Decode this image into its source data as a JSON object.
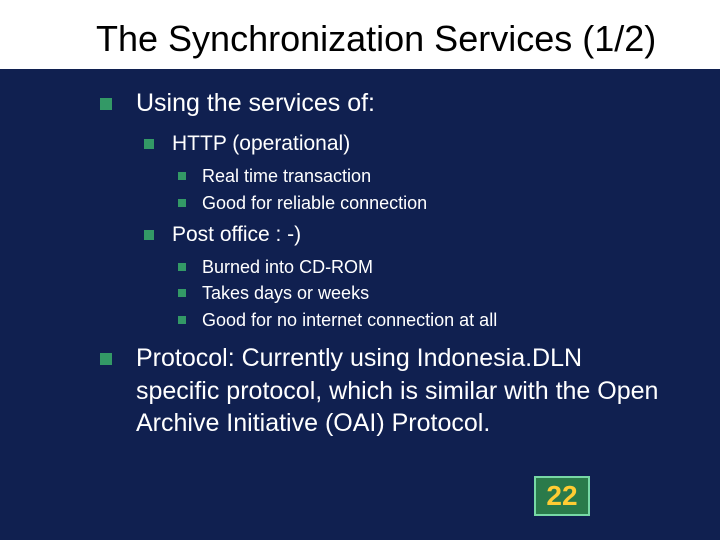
{
  "title": "The Synchronization Services (1/2)",
  "b1a": "Using the services of:",
  "b2a": "HTTP (operational)",
  "b3a": "Real time transaction",
  "b3b": "Good for reliable connection",
  "b2b": "Post office : -)",
  "b3c": "Burned into CD-ROM",
  "b3d": "Takes days or weeks",
  "b3e": "Good for no internet connection at all",
  "b1b": "Protocol: Currently using Indonesia.DLN specific protocol, which is similar with the Open Archive Initiative (OAI) Protocol.",
  "page": "22"
}
